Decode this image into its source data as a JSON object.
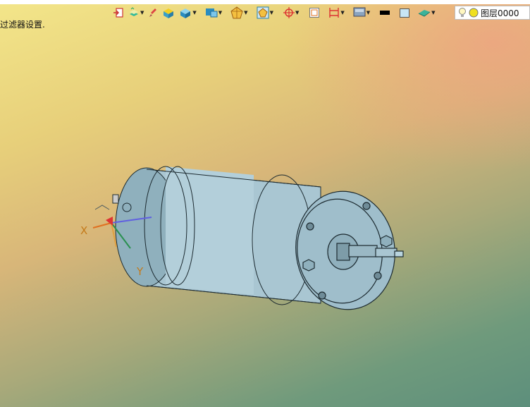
{
  "status": {
    "message": "过滤器设置."
  },
  "toolbar": {
    "buttons": [
      {
        "name": "export-icon"
      },
      {
        "name": "layers-icon"
      },
      {
        "name": "brush-icon"
      },
      {
        "name": "box-yellow-icon"
      },
      {
        "name": "box-blue-icon"
      },
      {
        "name": "cube-view-icon"
      },
      {
        "name": "polygon-icon"
      },
      {
        "name": "frame-icon"
      },
      {
        "name": "crosshair-icon"
      },
      {
        "name": "rect-select-icon"
      },
      {
        "name": "dimension-icon"
      },
      {
        "name": "monitor-icon"
      },
      {
        "name": "line-color-swatch"
      },
      {
        "name": "fill-color-swatch"
      },
      {
        "name": "surface-icon"
      }
    ],
    "line_color": "#000000",
    "fill_color": "#c8e6f6"
  },
  "layer": {
    "name": "图层0000",
    "bulb_icon": "lightbulb-icon",
    "status_icon": "yellow-dot-icon"
  },
  "viewport": {
    "axes": {
      "x_label": "X",
      "y_label": "Y"
    },
    "model_color": "#a9c6d2"
  }
}
